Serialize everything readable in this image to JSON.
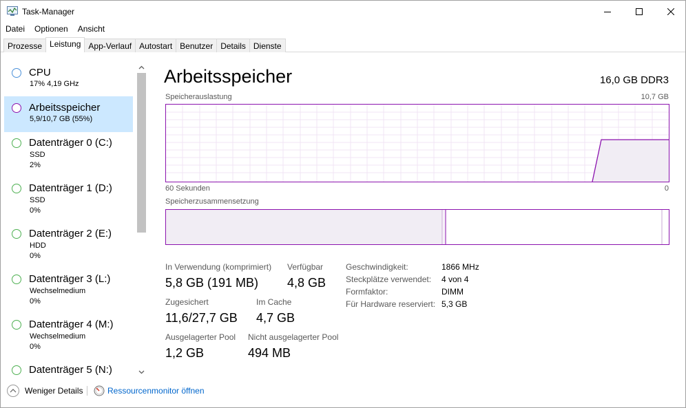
{
  "window": {
    "title": "Task-Manager",
    "colors": {
      "accent": "#8b12ae",
      "selected_bg": "#cce8ff",
      "link": "#0066cc"
    }
  },
  "menu": [
    {
      "label": "Datei"
    },
    {
      "label": "Optionen"
    },
    {
      "label": "Ansicht"
    }
  ],
  "tabs": [
    {
      "label": "Prozesse",
      "active": false
    },
    {
      "label": "Leistung",
      "active": true
    },
    {
      "label": "App-Verlauf",
      "active": false
    },
    {
      "label": "Autostart",
      "active": false
    },
    {
      "label": "Benutzer",
      "active": false
    },
    {
      "label": "Details",
      "active": false
    },
    {
      "label": "Dienste",
      "active": false
    }
  ],
  "sidebar": {
    "items": [
      {
        "title": "CPU",
        "line1": "17%  4,19 GHz",
        "line2": "",
        "selected": false,
        "circle_color": "#4a90d9"
      },
      {
        "title": "Arbeitsspeicher",
        "line1": "5,9/10,7 GB (55%)",
        "line2": "",
        "selected": true,
        "circle_color": "#8b12ae"
      },
      {
        "title": "Datenträger 0 (C:)",
        "line1": "SSD",
        "line2": "2%",
        "selected": false,
        "circle_color": "#4caf50"
      },
      {
        "title": "Datenträger 1 (D:)",
        "line1": "SSD",
        "line2": "0%",
        "selected": false,
        "circle_color": "#4caf50"
      },
      {
        "title": "Datenträger 2 (E:)",
        "line1": "HDD",
        "line2": "0%",
        "selected": false,
        "circle_color": "#4caf50"
      },
      {
        "title": "Datenträger 3 (L:)",
        "line1": "Wechselmedium",
        "line2": "0%",
        "selected": false,
        "circle_color": "#4caf50"
      },
      {
        "title": "Datenträger 4 (M:)",
        "line1": "Wechselmedium",
        "line2": "0%",
        "selected": false,
        "circle_color": "#4caf50"
      },
      {
        "title": "Datenträger 5 (N:)",
        "line1": "",
        "line2": "",
        "selected": false,
        "circle_color": "#4caf50"
      }
    ]
  },
  "main": {
    "title": "Arbeitsspeicher",
    "spec": "16,0 GB DDR3",
    "usage_label": "Speicherauslastung",
    "usage_max": "10,7 GB",
    "time_left": "60 Sekunden",
    "time_right": "0",
    "composition_label": "Speicherzusammensetzung",
    "stats": {
      "in_use_label": "In Verwendung (komprimiert)",
      "in_use_value": "5,8 GB (191 MB)",
      "available_label": "Verfügbar",
      "available_value": "4,8 GB",
      "committed_label": "Zugesichert",
      "committed_value": "11,6/27,7 GB",
      "cached_label": "Im Cache",
      "cached_value": "4,7 GB",
      "paged_label": "Ausgelagerter Pool",
      "paged_value": "1,2 GB",
      "nonpaged_label": "Nicht ausgelagerter Pool",
      "nonpaged_value": "494 MB"
    },
    "details": [
      {
        "key": "Geschwindigkeit:",
        "value": "1866 MHz"
      },
      {
        "key": "Steckplätze verwendet:",
        "value": "4 von 4"
      },
      {
        "key": "Formfaktor:",
        "value": "DIMM"
      },
      {
        "key": "Für Hardware reserviert:",
        "value": "5,3 GB"
      }
    ]
  },
  "footer": {
    "fewer_details": "Weniger Details",
    "resource_monitor": "Ressourcenmonitor öffnen"
  }
}
